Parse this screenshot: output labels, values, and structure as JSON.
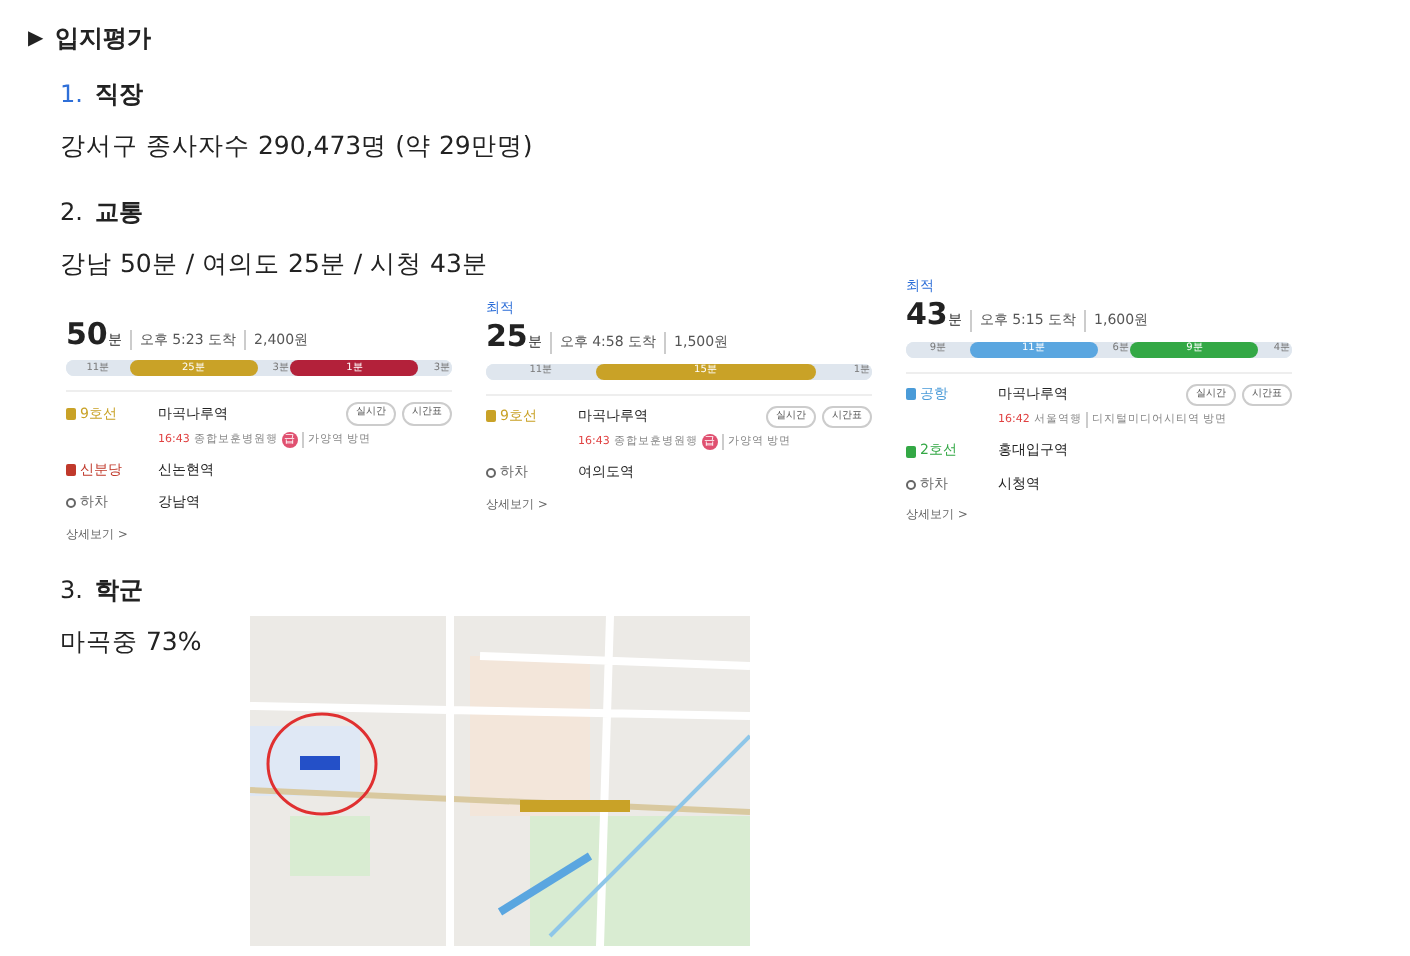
{
  "section": {
    "marker": "▶",
    "title": "입지평가"
  },
  "items": [
    {
      "number": "1.",
      "selected": true,
      "title": "직장",
      "text": "강서구 종사자수 290,473명 (약 29만명)"
    },
    {
      "number": "2.",
      "selected": false,
      "title": "교통",
      "text": "강남 50분 / 여의도 25분 / 시청 43분",
      "routes": [
        {
          "minutes": "50",
          "unit": "분",
          "arrival": "오후 5:23 도착",
          "fare": "2,400원",
          "segments": [
            {
              "kind": "walk",
              "label": "11분",
              "color": "#dfe6ee"
            },
            {
              "kind": "ride",
              "label": "25분",
              "color": "#c9a227"
            },
            {
              "kind": "gap",
              "label": "3분",
              "color": "#dfe6ee"
            },
            {
              "kind": "ride",
              "label": "1분",
              "color": "#b3213a"
            },
            {
              "kind": "gap",
              "label": "3분",
              "color": "#dfe6ee"
            }
          ],
          "steps": [
            {
              "kind": "ride",
              "line": "9호선",
              "color": "#c9a227",
              "station": "마곡나루역",
              "buttons": [
                "실시간",
                "시간표"
              ],
              "time": "16:43",
              "dest": "종합보훈병원행",
              "express": "급",
              "direction": "가양역 방면"
            },
            {
              "kind": "ride",
              "line": "신분당",
              "color": "#c0392b",
              "station": "신논현역"
            },
            {
              "kind": "alight",
              "line": "하차",
              "color": "#666666",
              "station": "강남역"
            }
          ],
          "more": "상세보기 >"
        },
        {
          "badge": "최적",
          "minutes": "25",
          "unit": "분",
          "arrival": "오후 4:58 도착",
          "fare": "1,500원",
          "segments": [
            {
              "kind": "walk",
              "label": "11분",
              "color": "#dfe6ee"
            },
            {
              "kind": "ride",
              "label": "15분",
              "color": "#c9a227"
            },
            {
              "kind": "gap",
              "label": "1분",
              "color": "#dfe6ee"
            }
          ],
          "steps": [
            {
              "kind": "ride",
              "line": "9호선",
              "color": "#c9a227",
              "station": "마곡나루역",
              "buttons": [
                "실시간",
                "시간표"
              ],
              "time": "16:43",
              "dest": "종합보훈병원행",
              "express": "급",
              "direction": "가양역 방면"
            },
            {
              "kind": "alight",
              "line": "하차",
              "color": "#666666",
              "station": "여의도역"
            }
          ],
          "more": "상세보기 >"
        },
        {
          "badge": "최적",
          "minutes": "43",
          "unit": "분",
          "arrival": "오후 5:15 도착",
          "fare": "1,600원",
          "segments": [
            {
              "kind": "walk",
              "label": "9분",
              "color": "#dfe6ee"
            },
            {
              "kind": "ride",
              "label": "11분",
              "color": "#5aa6e0"
            },
            {
              "kind": "gap",
              "label": "6분",
              "color": "#dfe6ee"
            },
            {
              "kind": "ride",
              "label": "9분",
              "color": "#33a845"
            },
            {
              "kind": "gap",
              "label": "4분",
              "color": "#dfe6ee"
            }
          ],
          "steps": [
            {
              "kind": "ride",
              "line": "공항",
              "color": "#4a9bd8",
              "station": "마곡나루역",
              "buttons": [
                "실시간",
                "시간표"
              ],
              "time": "16:42",
              "dest": "서울역행",
              "direction": "디지털미디어시티역 방면"
            },
            {
              "kind": "ride",
              "line": "2호선",
              "color": "#33a845",
              "station": "홍대입구역"
            },
            {
              "kind": "alight",
              "line": "하차",
              "color": "#666666",
              "station": "시청역"
            }
          ],
          "more": "상세보기 >"
        }
      ]
    },
    {
      "number": "3.",
      "selected": false,
      "title": "학군",
      "text": "마곡중 73%",
      "map": {
        "kind": "school-location"
      }
    }
  ]
}
